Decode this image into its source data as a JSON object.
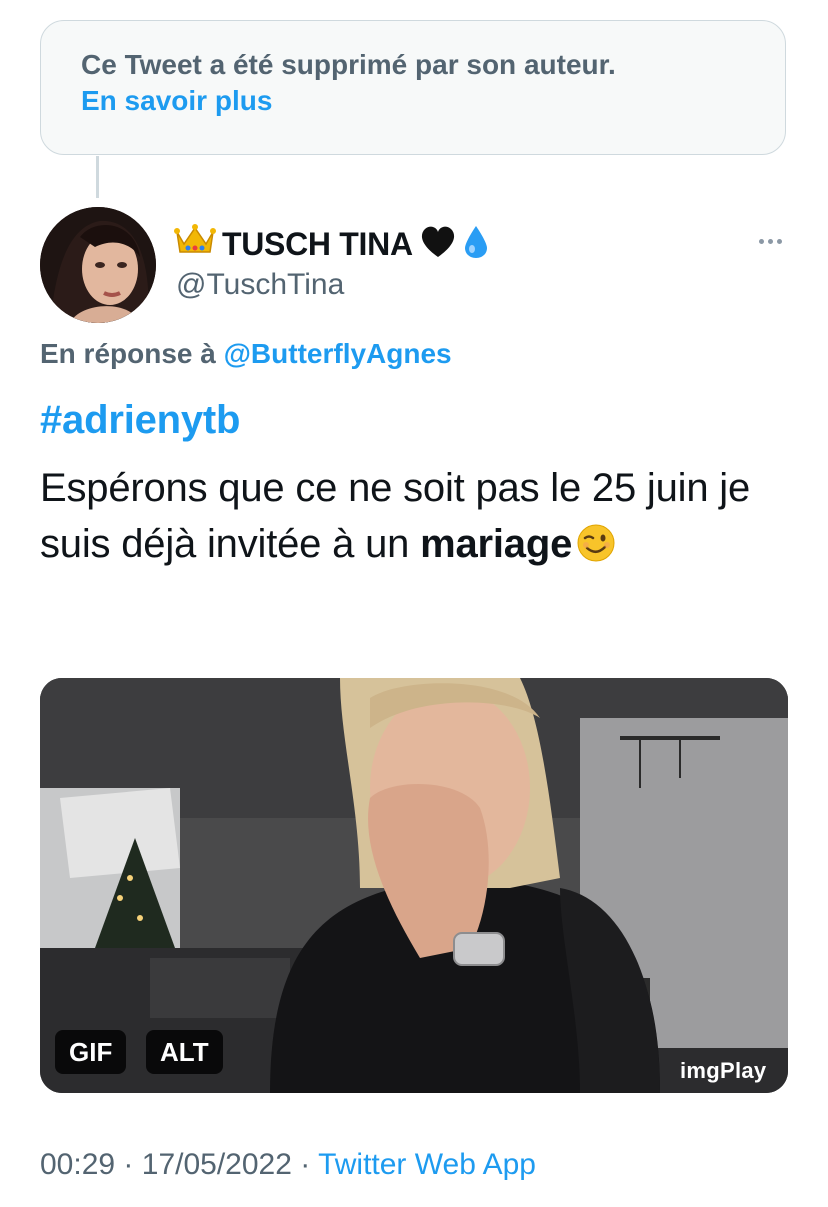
{
  "deleted_notice": {
    "text": "Ce Tweet a été supprimé par son auteur.",
    "link": "En savoir plus"
  },
  "author": {
    "display_name": "TUSCH TINA",
    "handle": "@TuschTina",
    "name_emojis": [
      "crown",
      "black-heart",
      "droplet"
    ]
  },
  "reply": {
    "prefix": "En réponse à",
    "handle": "@ButterflyAgnes"
  },
  "tweet": {
    "hashtag": "#adrienytb",
    "text_main": "Espérons que ce ne soit pas le 25 juin je suis déjà invitée à un",
    "text_bold": "mariage",
    "emoji": "winking-face"
  },
  "media": {
    "gif_label": "GIF",
    "alt_label": "ALT",
    "watermark": "imgPlay"
  },
  "meta": {
    "time": "00:29",
    "separator": "·",
    "date": "17/05/2022",
    "source": "Twitter Web App"
  },
  "colors": {
    "link": "#1d9bf0",
    "secondary_text": "#536471",
    "primary_text": "#0f1419",
    "border": "#cfd9de"
  }
}
